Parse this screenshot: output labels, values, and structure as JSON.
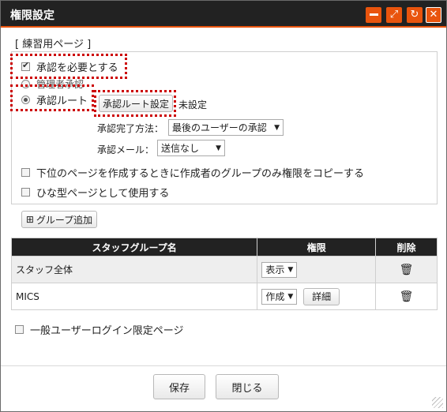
{
  "window": {
    "title": "権限設定"
  },
  "title_buttons": {
    "minimize_icon": "minimize-icon",
    "maximize_icon": "maximize-icon",
    "refresh_icon": "refresh-icon",
    "close_icon": "close-icon"
  },
  "section_label": "[ 練習用ページ ]",
  "approval": {
    "require_label": "承認を必要とする",
    "require_checked": true,
    "admin_approval_label": "管理者承認",
    "route_label": "承認ルート",
    "route_selected": true,
    "route_setting_button": "承認ルート設定",
    "route_status": "未設定",
    "completion_label": "承認完了方法：",
    "completion_value": "最後のユーザーの承認",
    "mail_label": "承認メール：",
    "mail_value": "送信なし"
  },
  "options": {
    "copy_group_label": "下位のページを作成するときに作成者のグループのみ権限をコピーする",
    "copy_group_checked": false,
    "template_label": "ひな型ページとして使用する",
    "template_checked": false
  },
  "add_group_button": "グループ追加",
  "table": {
    "headers": [
      "スタッフグループ名",
      "権限",
      "削除"
    ],
    "rows": [
      {
        "name": "スタッフ全体",
        "permission": "表示",
        "detail": ""
      },
      {
        "name": "MICS",
        "permission": "作成",
        "detail": "詳細"
      }
    ]
  },
  "login_limit": {
    "label": "一般ユーザーログイン限定ページ",
    "checked": false
  },
  "footer": {
    "save": "保存",
    "close": "閉じる"
  },
  "colors": {
    "accent": "#e9540d",
    "titlebar": "#222222",
    "highlight": "#cc0000"
  }
}
